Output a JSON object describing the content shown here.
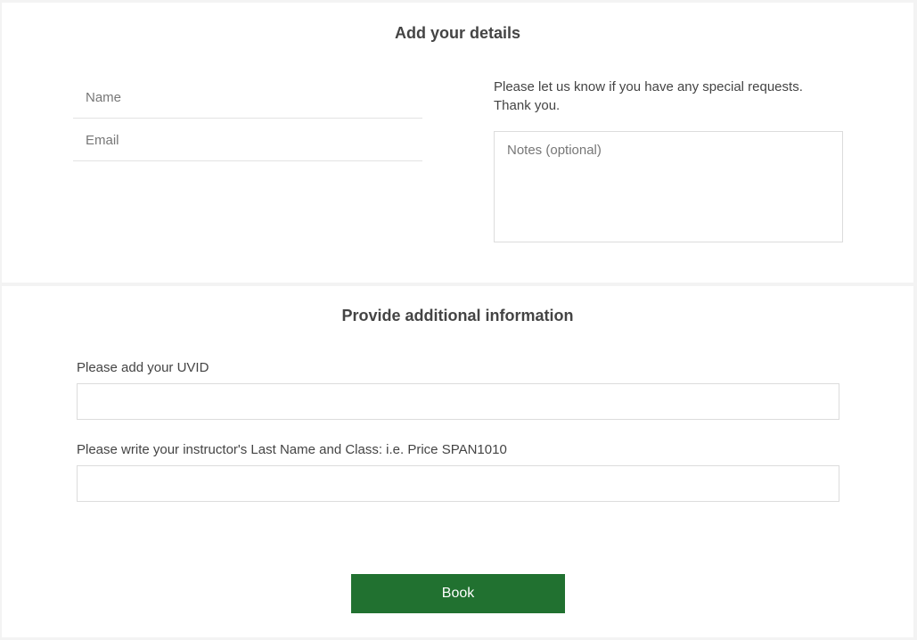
{
  "details_section": {
    "title": "Add your details",
    "name_placeholder": "Name",
    "email_placeholder": "Email",
    "requests_line1": "Please let us know if you have any special requests.",
    "requests_line2": "Thank you.",
    "notes_placeholder": "Notes (optional)"
  },
  "additional_section": {
    "title": "Provide additional information",
    "uvid_label": "Please add your UVID",
    "uvid_value": "",
    "instructor_label": "Please write your instructor's Last Name and Class: i.e. Price SPAN1010",
    "instructor_value": "",
    "book_label": "Book"
  },
  "colors": {
    "accent": "#217130",
    "background": "#f3f3f3",
    "card": "#ffffff",
    "border": "#dcdcdc"
  }
}
